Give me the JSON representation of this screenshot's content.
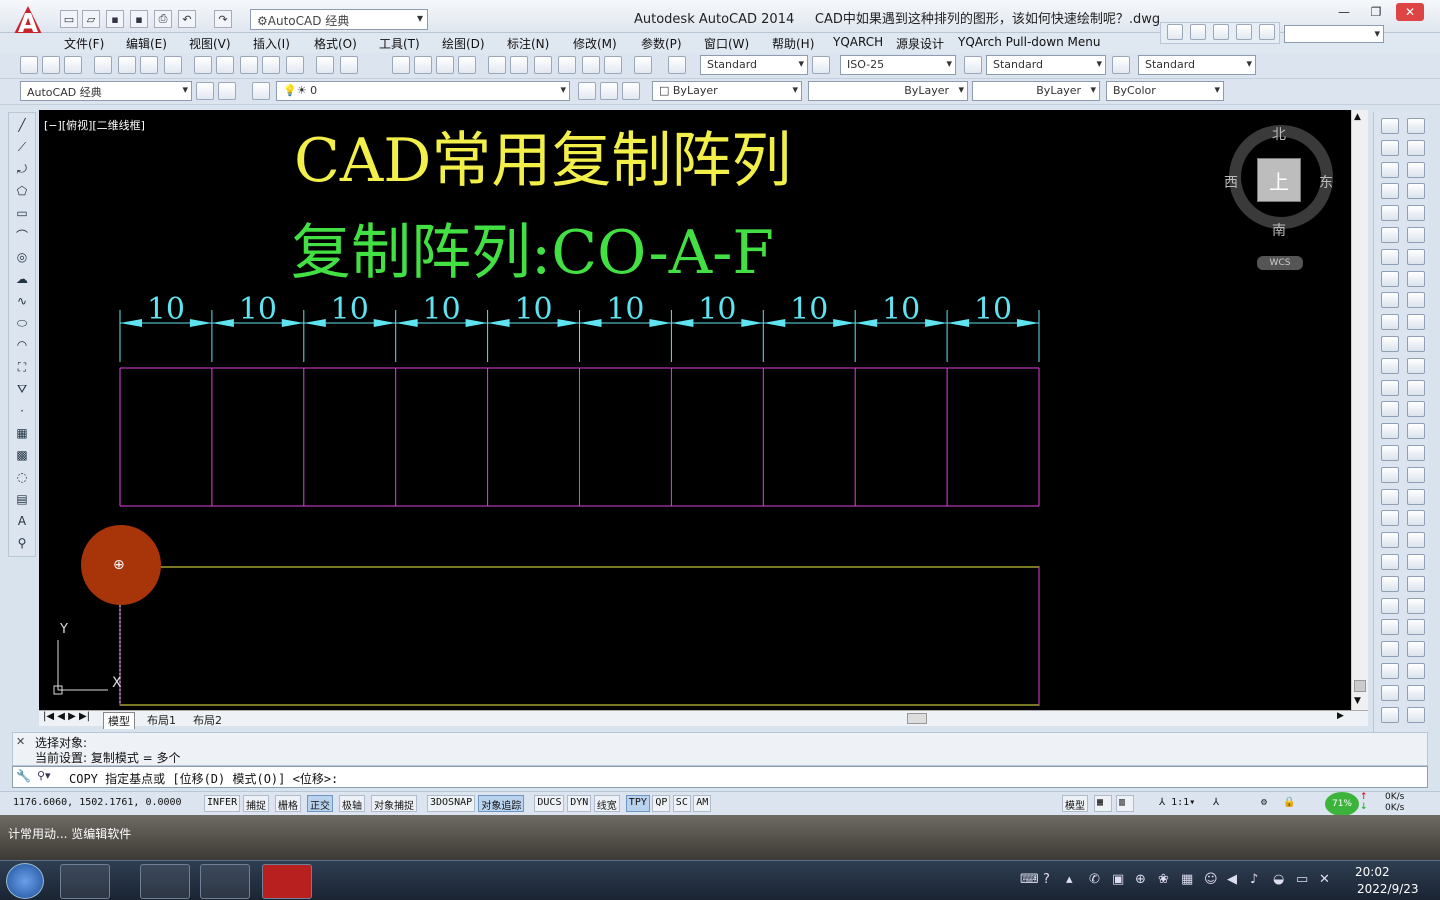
{
  "window": {
    "title": "Autodesk AutoCAD 2014",
    "document": "CAD中如果遇到这种排列的图形，该如何快速绘制呢？.dwg",
    "workspace": "AutoCAD 经典",
    "logo_letter": "A",
    "window_controls": [
      "—",
      "❐",
      "✕"
    ]
  },
  "menu": [
    "文件(F)",
    "编辑(E)",
    "视图(V)",
    "插入(I)",
    "格式(O)",
    "工具(T)",
    "绘图(D)",
    "标注(N)",
    "修改(M)",
    "参数(P)",
    "窗口(W)",
    "帮助(H)",
    "YQARCH",
    "源泉设计",
    "YQArch Pull-down Menu"
  ],
  "toolbar": {
    "text_style": "Standard",
    "dim_style": "ISO-25",
    "table_style": "Standard",
    "mleader_style": "Standard",
    "workspace2": "AutoCAD 经典",
    "layer": "0",
    "color": "ByLayer",
    "linetype": "ByLayer",
    "lineweight": "ByLayer",
    "plotstyle": "ByColor"
  },
  "viewport": {
    "label": "[−][俯视][二维线框]",
    "title1": "CAD常用复制阵列",
    "title2": "复制阵列:CO-A-F",
    "title1_color": "#f2ef4a",
    "title2_color": "#43e043",
    "dimension_values": [
      "10",
      "10",
      "10",
      "10",
      "10",
      "10",
      "10",
      "10",
      "10",
      "10"
    ],
    "dim_color": "#5fe3f0",
    "line_color": "#e040e0",
    "compass": {
      "n": "北",
      "s": "南",
      "e": "东",
      "w": "西",
      "top": "上",
      "wcs": "WCS"
    },
    "ucs": {
      "y": "Y",
      "x": "X"
    }
  },
  "tabs": [
    "模型",
    "布局1",
    "布局2"
  ],
  "command": {
    "history": [
      "选择对象:",
      "当前设置:   复制模式 = 多个"
    ],
    "prompt": "COPY 指定基点或 [位移(D) 模式(O)] <位移>:"
  },
  "status": {
    "coords": "1176.6060, 1502.1761, 0.0000",
    "toggles": [
      {
        "label": "INFER",
        "on": false
      },
      {
        "label": "捕捉",
        "on": false
      },
      {
        "label": "栅格",
        "on": false
      },
      {
        "label": "正交",
        "on": true
      },
      {
        "label": "极轴",
        "on": false
      },
      {
        "label": "对象捕捉",
        "on": false
      },
      {
        "label": "3DOSNAP",
        "on": false
      },
      {
        "label": "对象追踪",
        "on": true
      },
      {
        "label": "DUCS",
        "on": false
      },
      {
        "label": "DYN",
        "on": false
      },
      {
        "label": "线宽",
        "on": false
      },
      {
        "label": "TPY",
        "on": true
      },
      {
        "label": "QP",
        "on": false
      },
      {
        "label": "SC",
        "on": false
      },
      {
        "label": "AM",
        "on": false
      }
    ],
    "model": "模型",
    "scale": "1:1",
    "net_percent": "71%",
    "net_up": "0K/s",
    "net_down": "0K/s"
  },
  "desktop": {
    "text": "计常用动...   览编辑软件"
  },
  "taskbar": {
    "time": "20:02",
    "date": "2022/9/23"
  }
}
